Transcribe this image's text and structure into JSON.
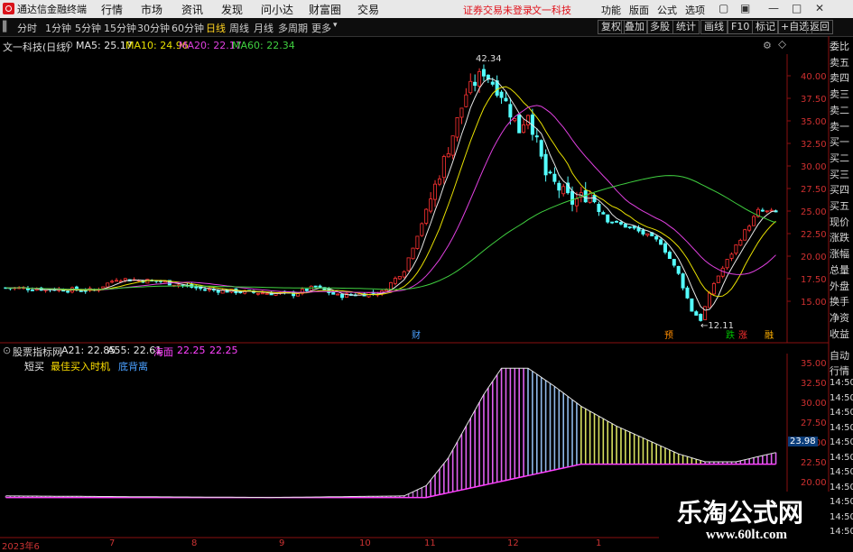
{
  "app": {
    "title": "通达信金融终端",
    "menu": [
      "行情",
      "市场",
      "资讯",
      "发现",
      "问小达",
      "财富圈",
      "交易"
    ],
    "notice": "证券交易未登录",
    "stock_name": "文一科技",
    "right_menu": [
      "功能",
      "版面",
      "公式",
      "选项"
    ],
    "window_buttons": [
      "—",
      "□",
      "✕"
    ]
  },
  "toolbar": {
    "periods": [
      "分时",
      "1分钟",
      "5分钟",
      "15分钟",
      "30分钟",
      "60分钟",
      "日线",
      "周线",
      "月线",
      "多周期",
      "更多"
    ],
    "active_period": "日线",
    "right_buttons": [
      "复权",
      "叠加",
      "多股",
      "统计",
      "画线",
      "F10",
      "标记",
      "+自选",
      "返回"
    ]
  },
  "main_chart": {
    "title": "文一科技(日线)",
    "ma_legend": [
      {
        "label": "MA5: 25.17",
        "color": "#e6e6e6"
      },
      {
        "label": "MA10: 24.96",
        "color": "#e8e000"
      },
      {
        "label": "MA20: 22.17",
        "color": "#e040e0"
      },
      {
        "label": "MA60: 22.34",
        "color": "#40d040"
      }
    ],
    "y_ticks": [
      "40.00",
      "37.50",
      "35.00",
      "32.50",
      "30.00",
      "27.50",
      "25.00",
      "22.50",
      "20.00",
      "17.50",
      "15.00"
    ],
    "high_label": "42.34",
    "low_label": "←12.11",
    "markers": [
      {
        "text": "财",
        "color": "#4aa0ff"
      },
      {
        "text": "预",
        "color": "#ff8c00"
      },
      {
        "text": "跌",
        "color": "#00c000"
      },
      {
        "text": "涨",
        "color": "#ff3030"
      },
      {
        "text": "融",
        "color": "#ffb000"
      }
    ]
  },
  "indicator": {
    "title": "股票指标网",
    "legend": [
      {
        "label": "A21: 22.85",
        "color": "#e6e6e6"
      },
      {
        "label": "A55: 22.61",
        "color": "#e6e6e6"
      },
      {
        "label": "海面",
        "color": "#ff40ff"
      },
      {
        "label": "22.25",
        "color": "#ff40ff"
      },
      {
        "label": "22.25",
        "color": "#ff40ff"
      }
    ],
    "legend2": [
      {
        "label": "短买",
        "color": "#e6e6e6"
      },
      {
        "label": "最佳买入时机",
        "color": "#ffe000"
      },
      {
        "label": "底背离",
        "color": "#4aa0ff"
      }
    ],
    "y_ticks": [
      "35.00",
      "32.50",
      "30.00",
      "27.50",
      "25.00",
      "22.50",
      "20.00"
    ],
    "current_value": "23.98"
  },
  "side_panel": [
    "委比",
    "卖五",
    "卖四",
    "卖三",
    "卖二",
    "卖一",
    "买一",
    "买二",
    "买三",
    "买四",
    "买五",
    "现价",
    "涨跌",
    "涨幅",
    "总量",
    "外盘",
    "换手",
    "净资",
    "收益"
  ],
  "side_panel2": [
    "自动",
    "行情",
    "14:50",
    "14:50",
    "14:50",
    "14:50",
    "14:50",
    "14:50",
    "14:50",
    "14:50",
    "14:50",
    "14:50",
    "14:50"
  ],
  "x_labels": [
    "2023年6",
    "7",
    "8",
    "9",
    "10",
    "11",
    "12",
    "1"
  ],
  "watermark": {
    "title": "乐淘公式网",
    "url": "www.60lt.com"
  },
  "colors": {
    "up": "#ff3232",
    "down": "#54ffff",
    "ma5": "#e6e6e6",
    "ma10": "#e8e000",
    "ma20": "#e040e0",
    "ma60": "#40d040",
    "axis": "#b01010"
  }
}
